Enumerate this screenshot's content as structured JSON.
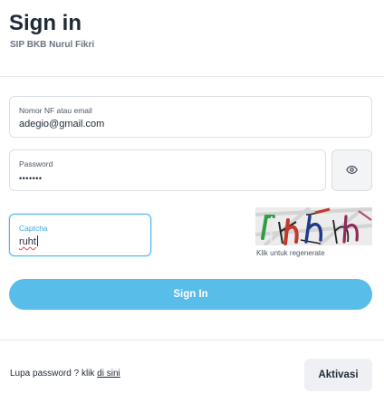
{
  "header": {
    "title": "Sign in",
    "subtitle": "SIP BKB Nurul Fikri"
  },
  "form": {
    "nf_email": {
      "label": "Nomor NF atau email",
      "value": "adegio@gmail.com"
    },
    "password": {
      "label": "Password",
      "value": "•••••••",
      "toggle_icon": "eye-icon"
    },
    "captcha": {
      "label": "Captcha",
      "value": "ruht",
      "image_hint": "Klik untuk regenerate"
    },
    "submit_label": "Sign In"
  },
  "footer": {
    "forgot_prefix": "Lupa password ? klik ",
    "forgot_link": "di sini",
    "aktivasi_label": "Aktivasi"
  },
  "colors": {
    "accent": "#58bde9",
    "focus_border": "#56b7e6",
    "text": "#1f2937"
  }
}
